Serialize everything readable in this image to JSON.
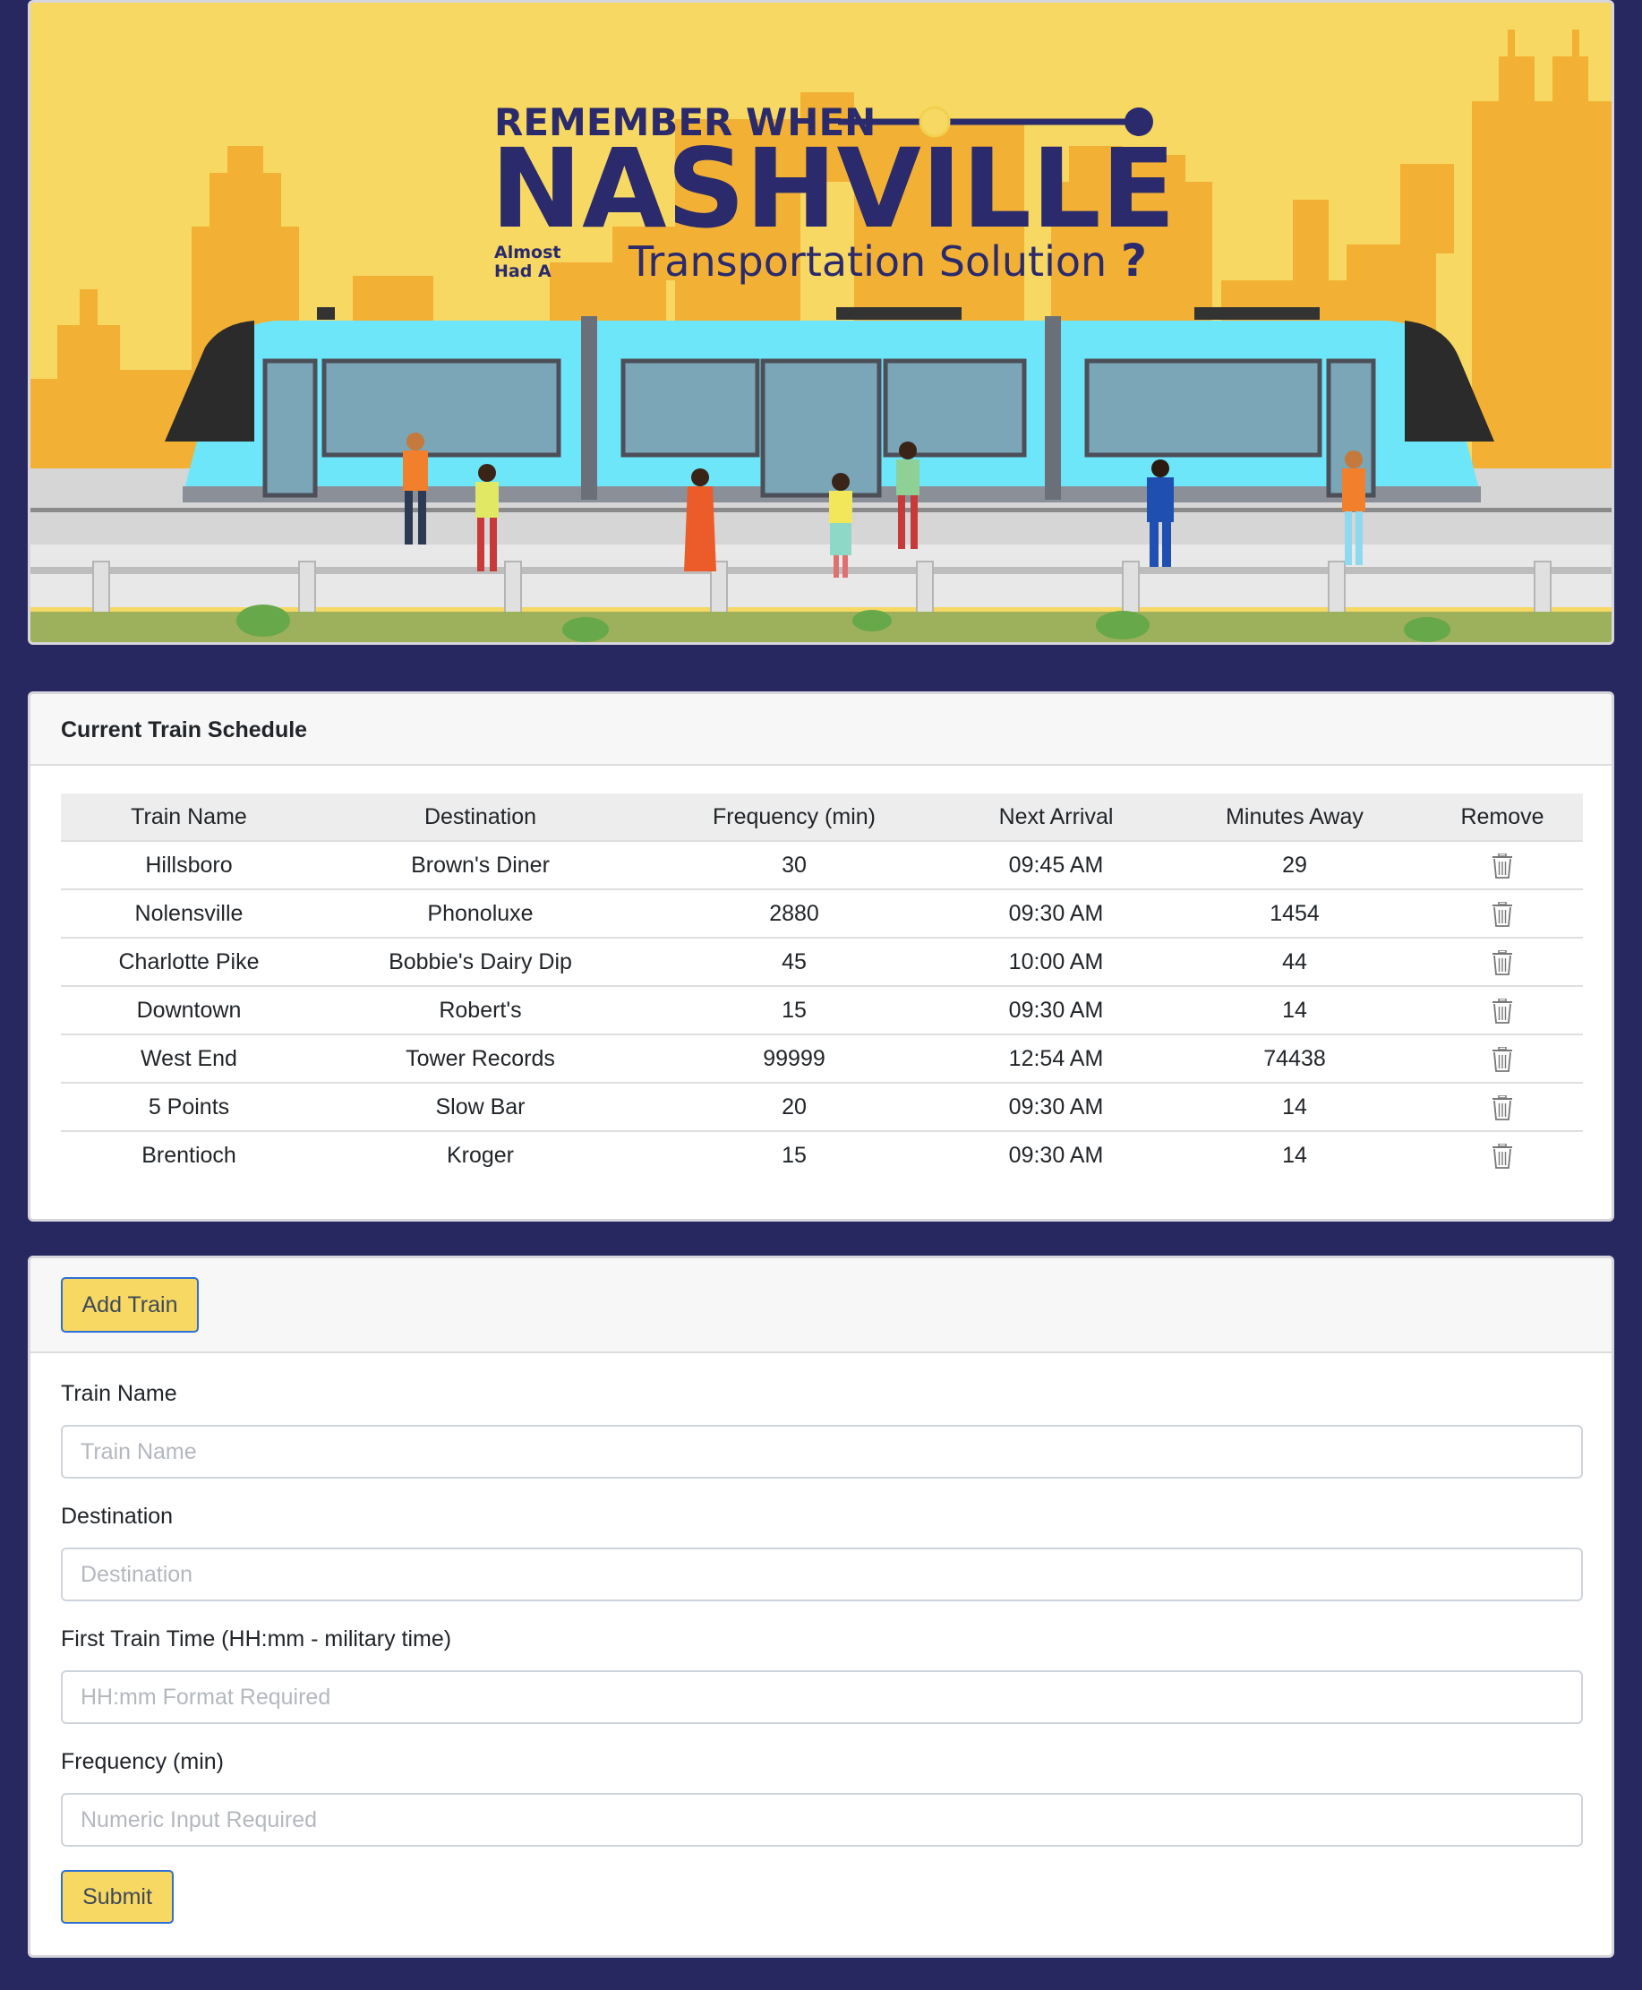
{
  "banner": {
    "line1": "REMEMBER WHEN",
    "line2": "NASHVILLE",
    "line3_small_a": "Almost",
    "line3_small_b": "Had A",
    "line3": "Transportation Solution",
    "question_mark": "?"
  },
  "schedule": {
    "title": "Current Train Schedule",
    "columns": [
      "Train Name",
      "Destination",
      "Frequency (min)",
      "Next Arrival",
      "Minutes Away",
      "Remove"
    ],
    "rows": [
      {
        "name": "Hillsboro",
        "destination": "Brown's Diner",
        "frequency": "30",
        "next": "09:45 AM",
        "away": "29"
      },
      {
        "name": "Nolensville",
        "destination": "Phonoluxe",
        "frequency": "2880",
        "next": "09:30 AM",
        "away": "1454"
      },
      {
        "name": "Charlotte Pike",
        "destination": "Bobbie's Dairy Dip",
        "frequency": "45",
        "next": "10:00 AM",
        "away": "44"
      },
      {
        "name": "Downtown",
        "destination": "Robert's",
        "frequency": "15",
        "next": "09:30 AM",
        "away": "14"
      },
      {
        "name": "West End",
        "destination": "Tower Records",
        "frequency": "99999",
        "next": "12:54 AM",
        "away": "74438"
      },
      {
        "name": "5 Points",
        "destination": "Slow Bar",
        "frequency": "20",
        "next": "09:30 AM",
        "away": "14"
      },
      {
        "name": "Brentioch",
        "destination": "Kroger",
        "frequency": "15",
        "next": "09:30 AM",
        "away": "14"
      }
    ]
  },
  "form": {
    "add_button": "Add Train",
    "name_label": "Train Name",
    "name_placeholder": "Train Name",
    "destination_label": "Destination",
    "destination_placeholder": "Destination",
    "first_time_label": "First Train Time (HH:mm - military time)",
    "first_time_placeholder": "HH:mm Format Required",
    "frequency_label": "Frequency (min)",
    "frequency_placeholder": "Numeric Input Required",
    "submit_button": "Submit"
  },
  "icons": {
    "remove": "trash-icon"
  },
  "colors": {
    "page_background": "#282860",
    "banner_yellow": "#f6d862",
    "skyline_orange": "#f2b134",
    "title_navy": "#2a2a6c",
    "train_cyan": "#6ee6fa",
    "button_yellow": "#f6d862",
    "button_border": "#2f6fd8"
  }
}
